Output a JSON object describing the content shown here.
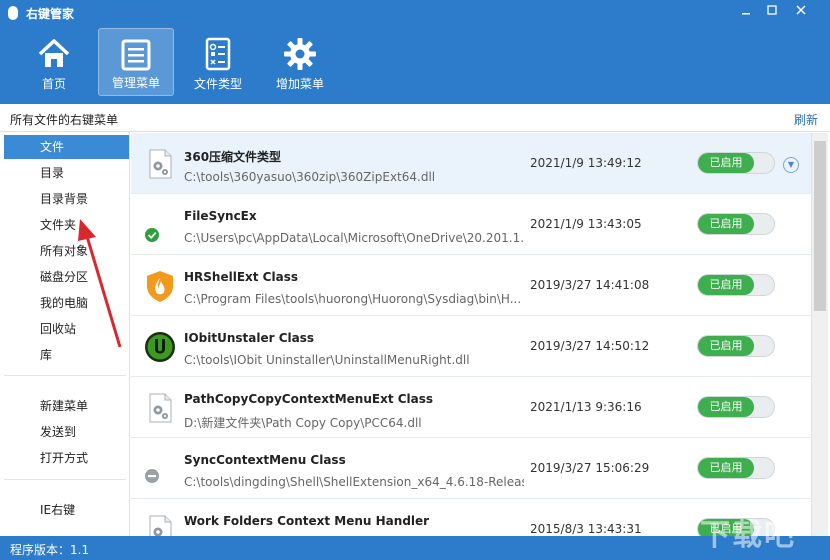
{
  "window": {
    "title": "右键管家",
    "controls": [
      "minimize",
      "maximize",
      "close"
    ]
  },
  "toolbar": {
    "items": [
      {
        "label": "首页",
        "icon": "home-icon"
      },
      {
        "label": "管理菜单",
        "icon": "menu-list-icon",
        "active": true
      },
      {
        "label": "文件类型",
        "icon": "file-type-icon"
      },
      {
        "label": "增加菜单",
        "icon": "gear-icon"
      }
    ]
  },
  "breadcrumb": {
    "text": "所有文件的右键菜单",
    "refresh": "刷新"
  },
  "sidebar": {
    "items": [
      {
        "label": "文件",
        "active": true
      },
      {
        "label": "目录"
      },
      {
        "label": "目录背景"
      },
      {
        "label": "文件夹"
      },
      {
        "label": "所有对象"
      },
      {
        "label": "磁盘分区"
      },
      {
        "label": "我的电脑"
      },
      {
        "label": "回收站"
      },
      {
        "label": "库"
      },
      {
        "label": "新建菜单"
      },
      {
        "label": "发送到"
      },
      {
        "label": "打开方式"
      },
      {
        "label": "IE右键"
      }
    ]
  },
  "entries": [
    {
      "name": "360压缩文件类型",
      "path": "C:\\tools\\360yasuo\\360zip\\360ZipExt64.dll",
      "time": "2021/1/9 13:49:12",
      "status": "已启用",
      "icon": "dll-gear-icon",
      "selected": true
    },
    {
      "name": "FileSyncEx",
      "path": "C:\\Users\\pc\\AppData\\Local\\Microsoft\\OneDrive\\20.201.1...",
      "time": "2021/1/9 13:43:05",
      "status": "已启用",
      "icon": "green-check-icon"
    },
    {
      "name": "HRShellExt Class",
      "path": "C:\\Program Files\\tools\\huorong\\Huorong\\Sysdiag\\bin\\H...",
      "time": "2019/3/27 14:41:08",
      "status": "已启用",
      "icon": "huorong-shield-icon"
    },
    {
      "name": "IObitUnstaler Class",
      "path": "C:\\tools\\IObit Uninstaller\\UninstallMenuRight.dll",
      "time": "2019/3/27 14:50:12",
      "status": "已启用",
      "icon": "iobit-uninstaller-icon"
    },
    {
      "name": "PathCopyCopyContextMenuExt Class",
      "path": "D:\\新建文件夹\\Path Copy Copy\\PCC64.dll",
      "time": "2021/1/13 9:36:16",
      "status": "已启用",
      "icon": "dll-gear-icon"
    },
    {
      "name": "SyncContextMenu Class",
      "path": "C:\\tools\\dingding\\Shell\\ShellExtension_x64_4.6.18-Releas...",
      "time": "2019/3/27 15:06:29",
      "status": "已启用",
      "icon": "minus-circle-icon"
    },
    {
      "name": "Work Folders Context Menu Handler",
      "path": "",
      "time": "2015/8/3 13:43:31",
      "status": "已启用",
      "icon": "dll-gear-icon"
    }
  ],
  "statusbar": {
    "version": "程序版本：1.1"
  },
  "watermark": "下载吧",
  "colors": {
    "header": "#2c7ccb",
    "sidebar_active": "#3a8ad6",
    "toggle_on": "#3fae4f",
    "annotation_arrow": "#d9272e"
  }
}
